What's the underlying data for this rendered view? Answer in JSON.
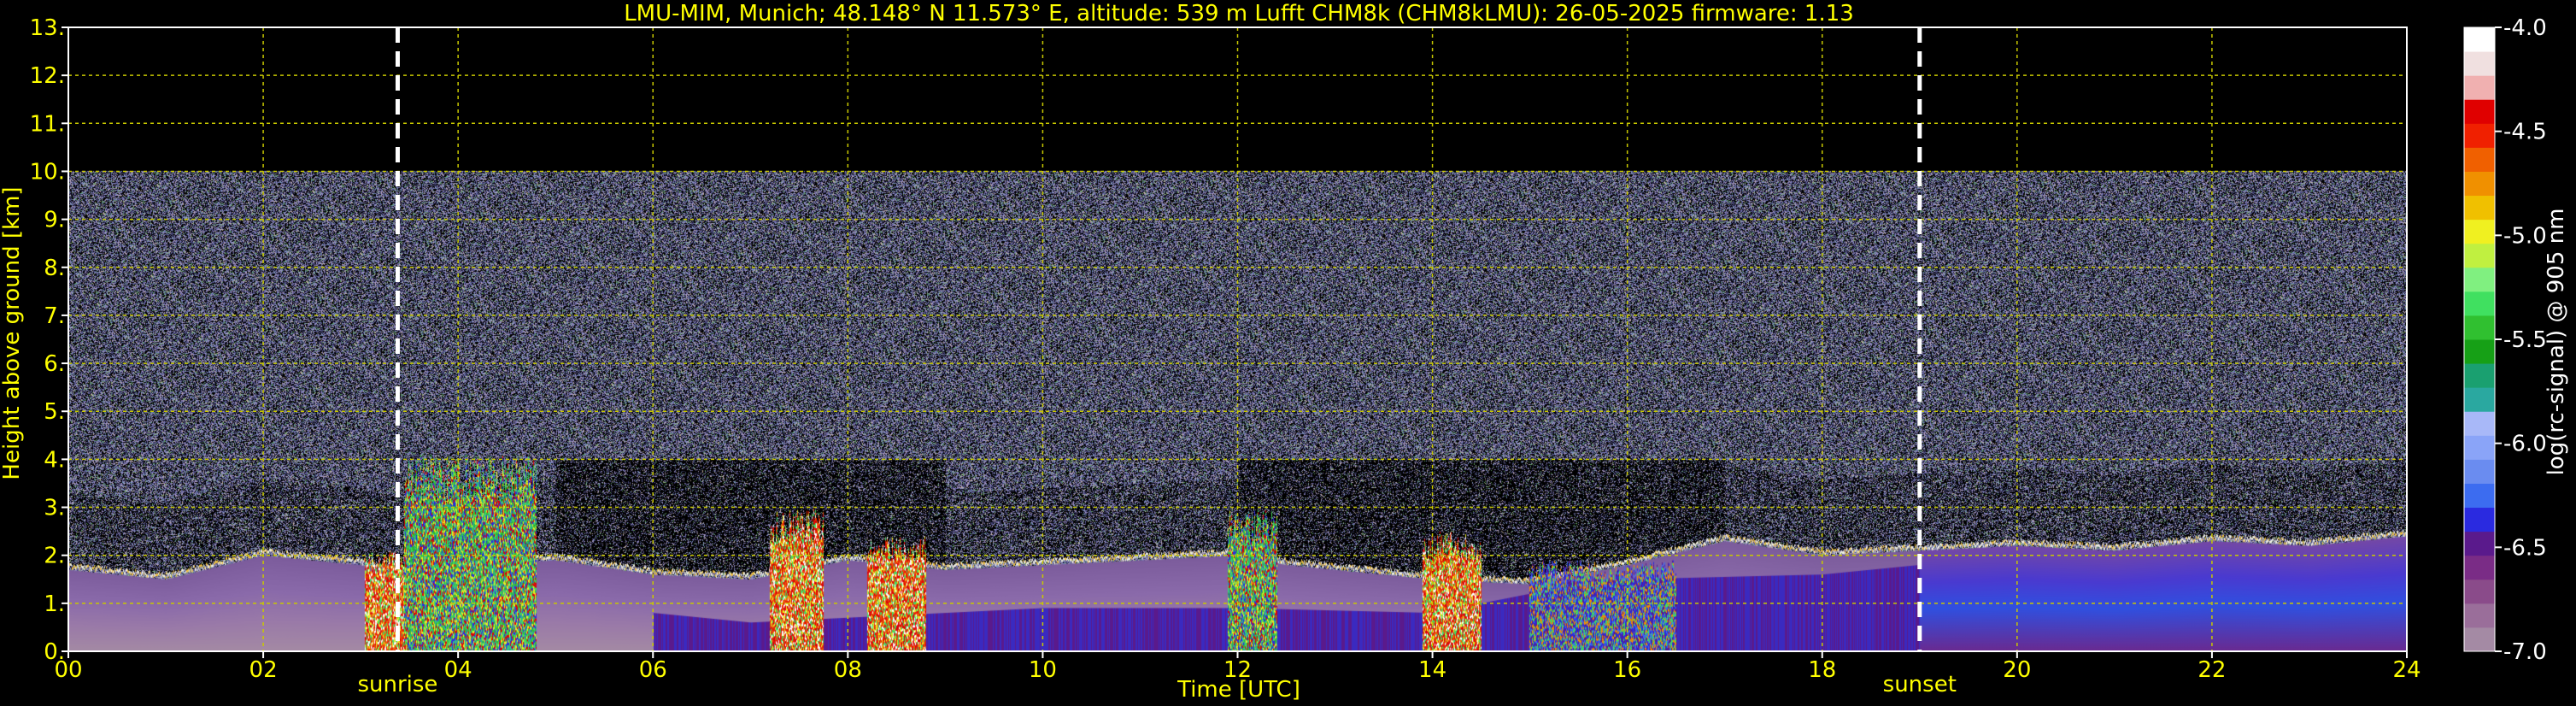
{
  "chart_data": {
    "type": "heatmap",
    "title": "LMU-MIM, Munich; 48.148° N 11.573° E, altitude: 539 m    Lufft CHM8k (CHM8kLMU): 26-05-2025    firmware: 1.13",
    "xlabel": "Time [UTC]",
    "ylabel": "Height above ground [km]",
    "xlim": [
      0,
      24
    ],
    "ylim": [
      0,
      13
    ],
    "x_ticks": [
      "00",
      "02",
      "04",
      "06",
      "08",
      "10",
      "12",
      "14",
      "16",
      "18",
      "20",
      "22",
      "24"
    ],
    "y_ticks": [
      "0.",
      "1.",
      "2.",
      "3.",
      "4.",
      "5.",
      "6.",
      "7.",
      "8.",
      "9.",
      "10.",
      "11.",
      "12.",
      "13."
    ],
    "grid": true,
    "signal_top_km": 10,
    "events": [
      {
        "label": "sunrise",
        "time": 3.38
      },
      {
        "label": "sunset",
        "time": 19.0
      }
    ],
    "colorbar": {
      "label": "log(rc-signal) @ 905 nm",
      "range": [
        -7.0,
        -4.0
      ],
      "ticks": [
        "-4.0",
        "-4.5",
        "-5.0",
        "-5.5",
        "-6.0",
        "-6.5",
        "-7.0"
      ],
      "colors": [
        "#a48aa4",
        "#9a6e9a",
        "#8a4b8a",
        "#7a2c86",
        "#5a1a8c",
        "#2a2ae0",
        "#3c6cf0",
        "#6a8cf0",
        "#8aa4f8",
        "#a8b8f8",
        "#2aa8a0",
        "#1aa070",
        "#16a016",
        "#30c030",
        "#40e060",
        "#80f080",
        "#c0f040",
        "#f0f020",
        "#f0c000",
        "#f09000",
        "#f06000",
        "#f02000",
        "#e00000",
        "#f0b0b0",
        "#f0e0e0",
        "#ffffff"
      ]
    },
    "boundary_layer_top_km": {
      "x": [
        0,
        1,
        2,
        3,
        3.4,
        4,
        5,
        6,
        7,
        8,
        9,
        10,
        11,
        12,
        12.5,
        13,
        14,
        15,
        16,
        17,
        18,
        19,
        20,
        21,
        22,
        23,
        24
      ],
      "y": [
        1.8,
        1.6,
        2.1,
        1.9,
        1.7,
        1.9,
        2.0,
        1.7,
        1.6,
        2.0,
        1.8,
        1.9,
        2.0,
        2.1,
        1.9,
        1.8,
        1.6,
        1.5,
        1.9,
        2.4,
        2.1,
        2.2,
        2.3,
        2.2,
        2.4,
        2.3,
        2.5
      ]
    },
    "mixing_layer_km": {
      "x": [
        0,
        2,
        3,
        4,
        6,
        7,
        8,
        9,
        10,
        12,
        14,
        15,
        16,
        18,
        19,
        20,
        22,
        24
      ],
      "y": [
        1.4,
        1.3,
        1.5,
        1.2,
        0.8,
        0.6,
        0.7,
        0.8,
        0.9,
        0.9,
        0.8,
        1.2,
        1.5,
        1.6,
        1.8,
        1.9,
        1.8,
        1.8
      ]
    },
    "plumes": [
      {
        "x0": 3.05,
        "x1": 3.45,
        "top": 2.1,
        "kind": "red"
      },
      {
        "x0": 3.45,
        "x1": 4.8,
        "top": 4.1,
        "kind": "green"
      },
      {
        "x0": 7.2,
        "x1": 7.75,
        "top": 3.0,
        "kind": "red"
      },
      {
        "x0": 8.2,
        "x1": 8.8,
        "top": 2.4,
        "kind": "red"
      },
      {
        "x0": 11.9,
        "x1": 12.4,
        "top": 3.0,
        "kind": "green"
      },
      {
        "x0": 13.9,
        "x1": 14.5,
        "top": 2.5,
        "kind": "red"
      },
      {
        "x0": 15.0,
        "x1": 16.5,
        "top": 1.9,
        "kind": "blue"
      }
    ]
  }
}
